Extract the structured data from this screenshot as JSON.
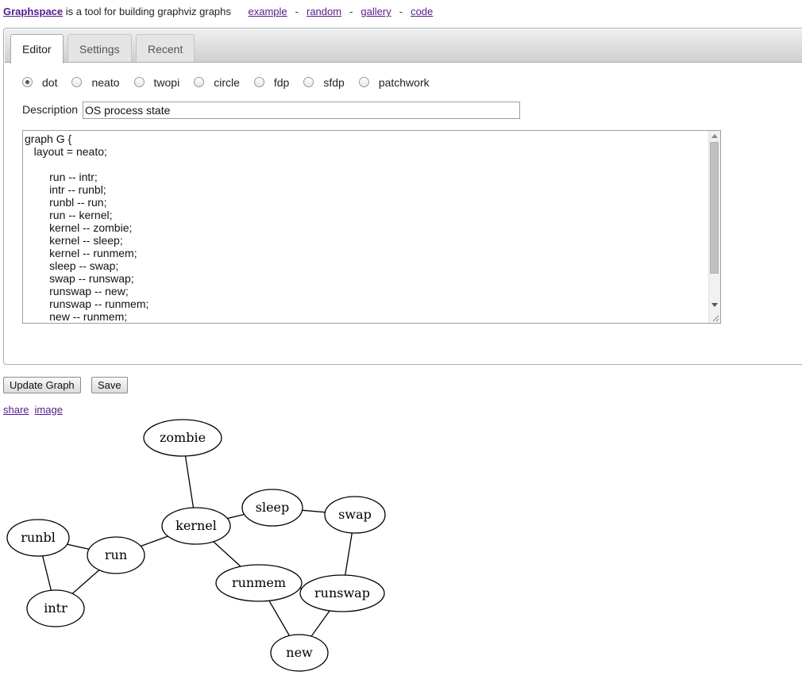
{
  "header": {
    "brand": "Graphspace",
    "tagline": " is a tool for building graphviz graphs",
    "links": [
      "example",
      "random",
      "gallery",
      "code"
    ],
    "separator": "-"
  },
  "tabs": [
    {
      "label": "Editor",
      "active": true
    },
    {
      "label": "Settings",
      "active": false
    },
    {
      "label": "Recent",
      "active": false
    }
  ],
  "layouts": {
    "options": [
      "dot",
      "neato",
      "twopi",
      "circle",
      "fdp",
      "sfdp",
      "patchwork"
    ],
    "selected": "dot"
  },
  "description": {
    "label": "Description",
    "value": "OS process state"
  },
  "code": "graph G {\n   layout = neato;\n\n        run -- intr;\n        intr -- runbl;\n        runbl -- run;\n        run -- kernel;\n        kernel -- zombie;\n        kernel -- sleep;\n        kernel -- runmem;\n        sleep -- swap;\n        swap -- runswap;\n        runswap -- new;\n        runswap -- runmem;\n        new -- runmem;",
  "buttons": {
    "update": "Update Graph",
    "save": "Save"
  },
  "share_links": {
    "share": "share",
    "image": "image"
  },
  "graph": {
    "nodes": [
      "zombie",
      "kernel",
      "sleep",
      "swap",
      "runbl",
      "run",
      "runmem",
      "runswap",
      "intr",
      "new"
    ],
    "edges": [
      [
        "run",
        "intr"
      ],
      [
        "intr",
        "runbl"
      ],
      [
        "runbl",
        "run"
      ],
      [
        "run",
        "kernel"
      ],
      [
        "kernel",
        "zombie"
      ],
      [
        "kernel",
        "sleep"
      ],
      [
        "kernel",
        "runmem"
      ],
      [
        "sleep",
        "swap"
      ],
      [
        "swap",
        "runswap"
      ],
      [
        "runswap",
        "new"
      ],
      [
        "runswap",
        "runmem"
      ],
      [
        "new",
        "runmem"
      ]
    ]
  }
}
